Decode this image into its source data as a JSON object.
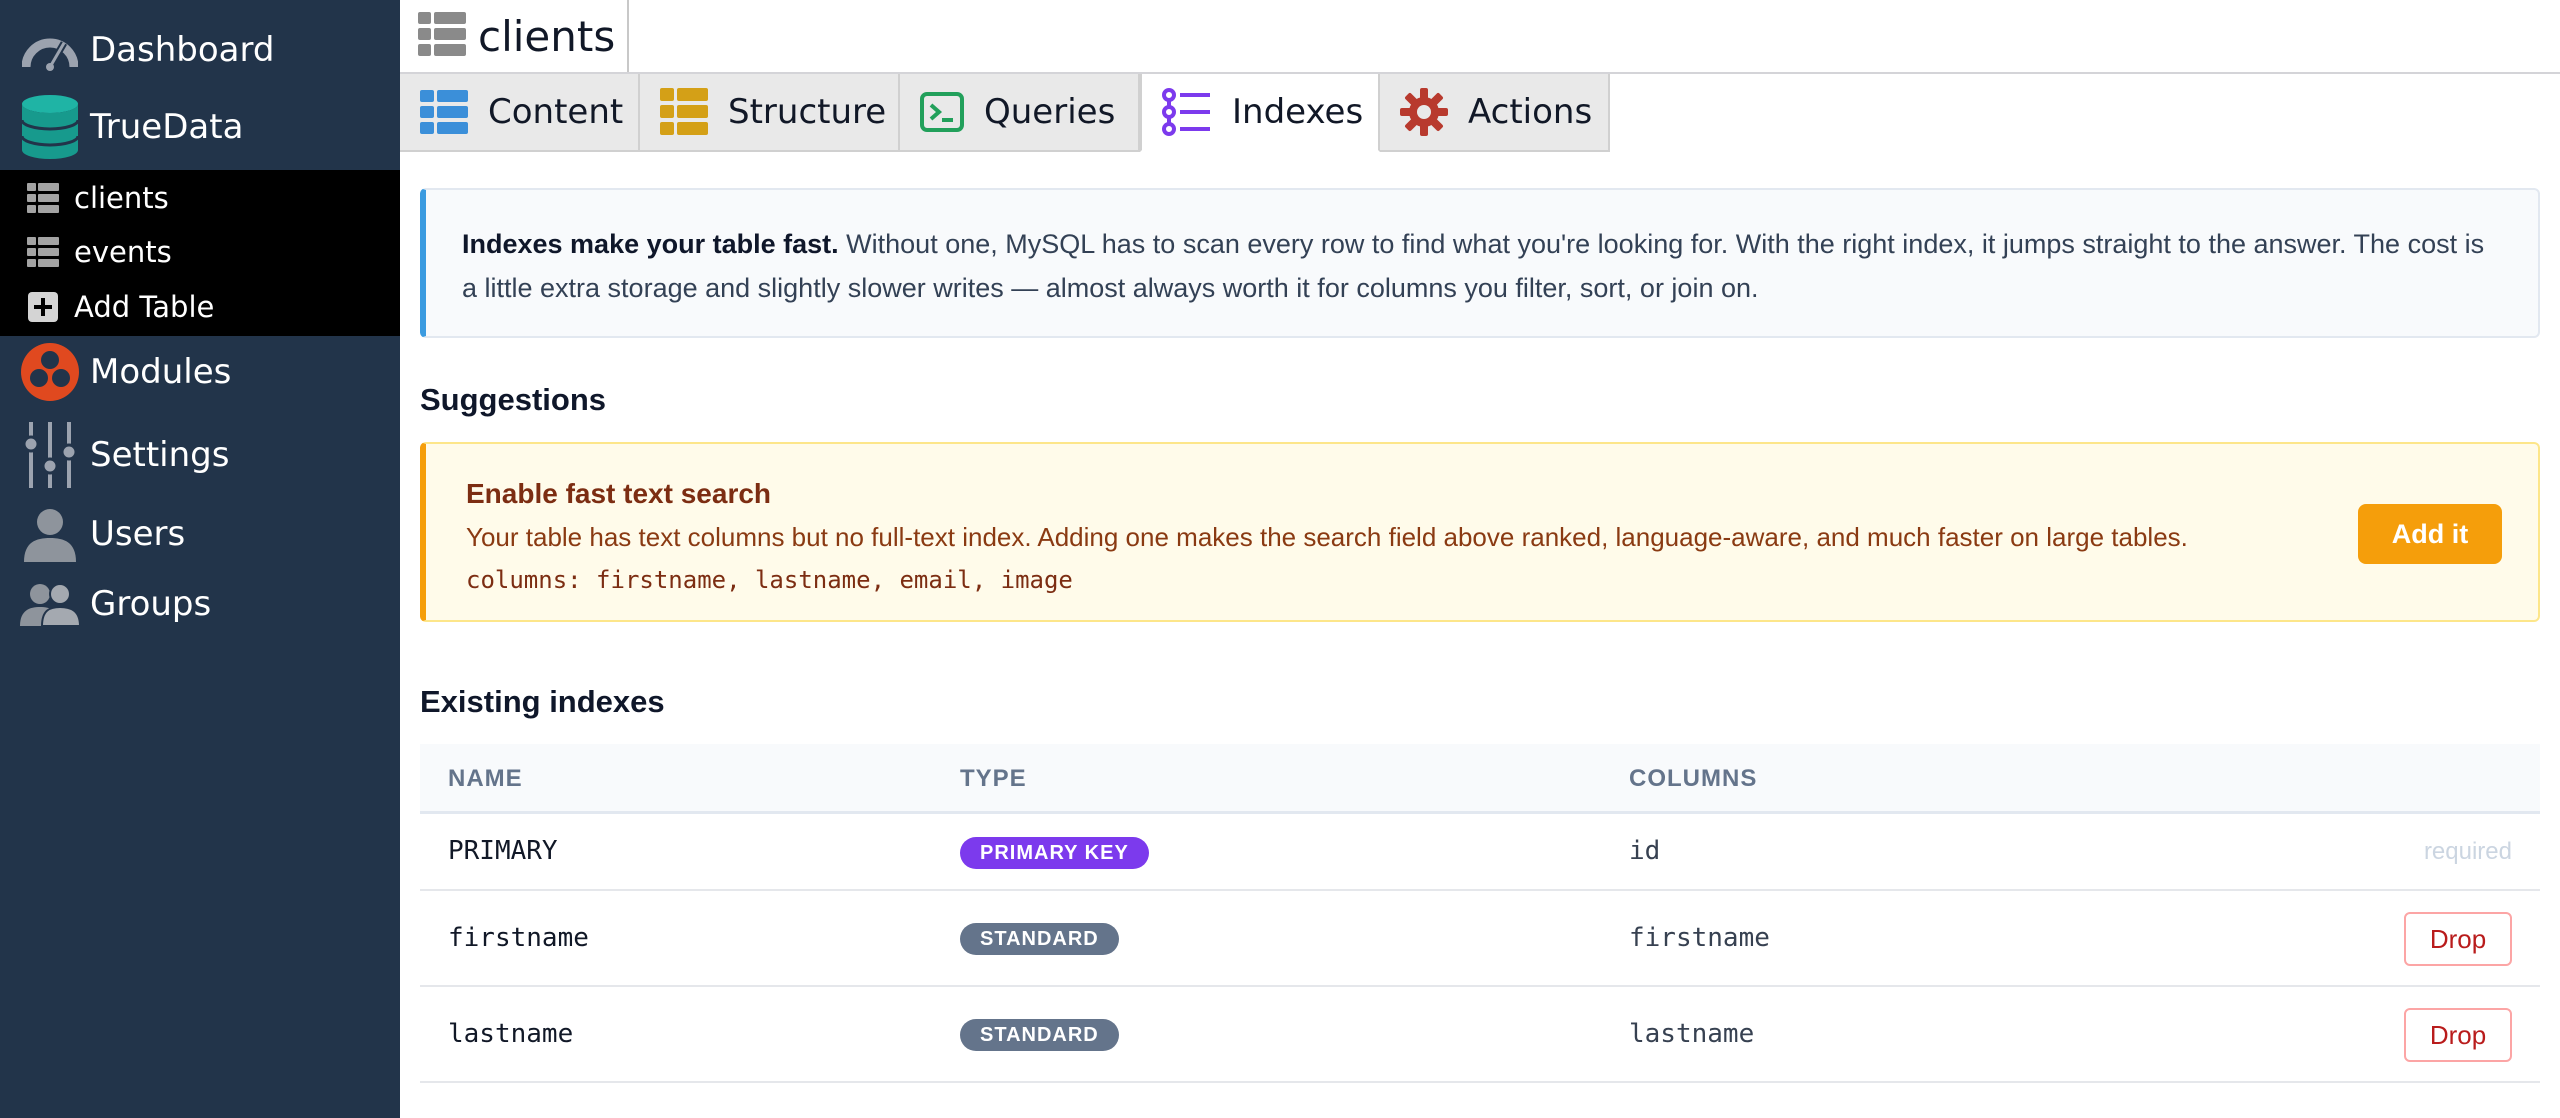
{
  "sidebar": {
    "items": [
      {
        "label": "Dashboard",
        "icon": "dashboard-gauge-icon"
      },
      {
        "label": "TrueData",
        "icon": "database-icon"
      },
      {
        "label": "Modules",
        "icon": "modules-icon"
      },
      {
        "label": "Settings",
        "icon": "sliders-icon"
      },
      {
        "label": "Users",
        "icon": "user-icon"
      },
      {
        "label": "Groups",
        "icon": "users-group-icon"
      }
    ],
    "tables": [
      {
        "label": "clients",
        "icon": "table-icon"
      },
      {
        "label": "events",
        "icon": "table-icon"
      },
      {
        "label": "Add Table",
        "icon": "plus-square-icon"
      }
    ]
  },
  "header": {
    "title": "clients"
  },
  "tabs": [
    {
      "label": "Content",
      "icon": "grid-icon",
      "color": "#3b8fd9"
    },
    {
      "label": "Structure",
      "icon": "structure-icon",
      "color": "#d4a017"
    },
    {
      "label": "Queries",
      "icon": "terminal-icon",
      "color": "#22a05b"
    },
    {
      "label": "Indexes",
      "icon": "list-icon",
      "color": "#7c3aed",
      "active": true
    },
    {
      "label": "Actions",
      "icon": "gear-icon",
      "color": "#b83a2e"
    }
  ],
  "info": {
    "bold": "Indexes make your table fast.",
    "text": " Without one, MySQL has to scan every row to find what you're looking for. With the right index, it jumps straight to the answer. The cost is a little extra storage and slightly slower writes — almost always worth it for columns you filter, sort, or join on."
  },
  "suggestions": {
    "heading": "Suggestions",
    "card": {
      "title": "Enable fast text search",
      "text": "Your table has text columns but no full-text index. Adding one makes the search field above ranked, language-aware, and much faster on large tables.",
      "columns": "columns: firstname, lastname, email, image",
      "button": "Add it"
    }
  },
  "existing": {
    "heading": "Existing indexes",
    "headers": {
      "name": "NAME",
      "type": "TYPE",
      "columns": "COLUMNS"
    },
    "rows": [
      {
        "name": "PRIMARY",
        "type": "PRIMARY KEY",
        "columns": "id",
        "action": "required"
      },
      {
        "name": "firstname",
        "type": "STANDARD",
        "columns": "firstname",
        "action": "Drop"
      },
      {
        "name": "lastname",
        "type": "STANDARD",
        "columns": "lastname",
        "action": "Drop"
      }
    ]
  },
  "colors": {
    "sidebar_bg": "#22344a",
    "info_accent": "#3b9be0",
    "suggest_accent": "#f59e0b",
    "primary_badge": "#7c3aed",
    "standard_badge": "#64748b",
    "drop": "#b91c1c"
  }
}
